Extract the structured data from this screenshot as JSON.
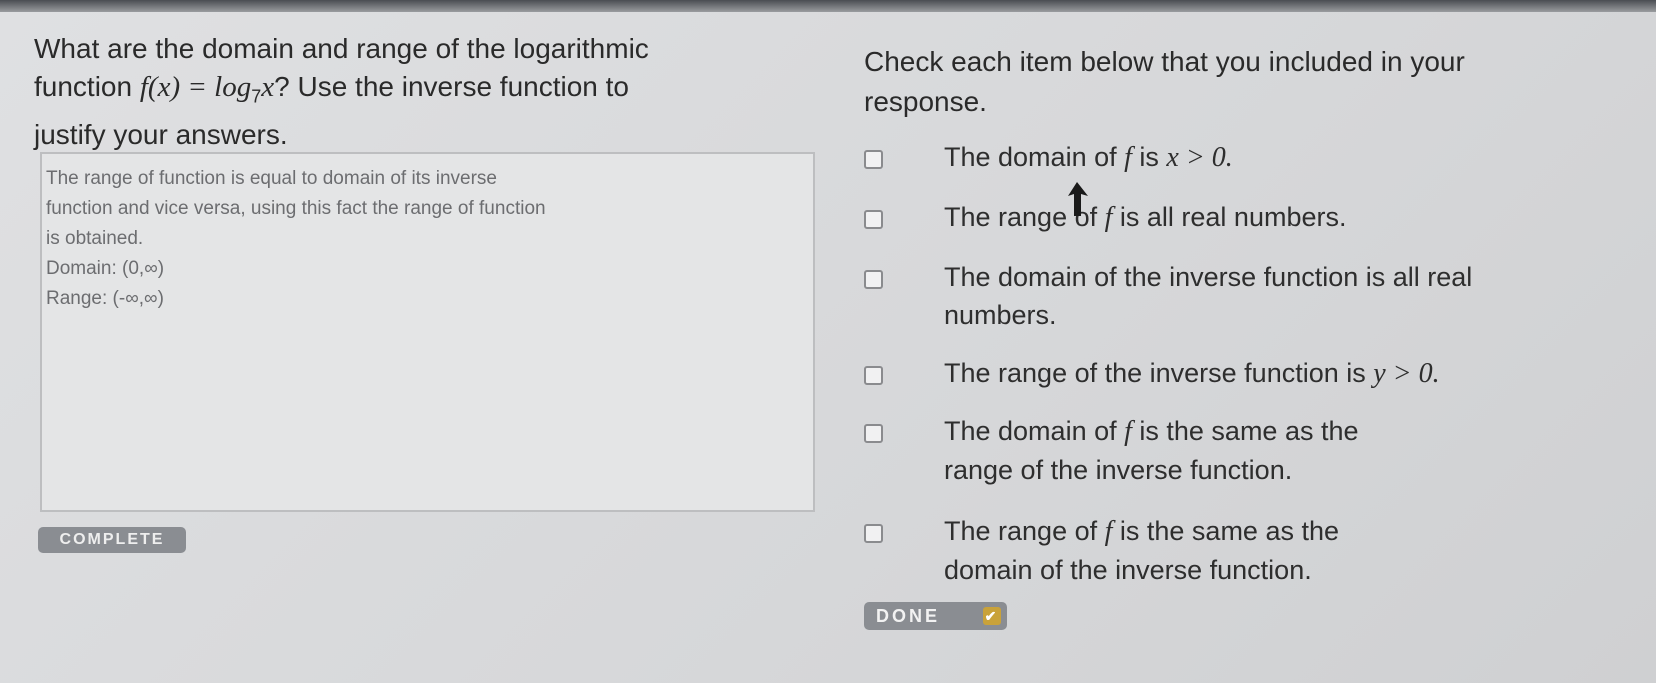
{
  "question": {
    "line1": "What are the domain and range of the logarithmic",
    "line2_pre": "function ",
    "line2_func": "f(x) = log",
    "line2_sub": "7",
    "line2_var": "x",
    "line2_post": "? Use the inverse function to",
    "line3": "justify your answers."
  },
  "answer": {
    "line1": "The range of function is equal to domain of its inverse",
    "line2": "function and vice versa, using this fact the range of function",
    "line3": "is obtained.",
    "line4": "Domain: (0,∞)",
    "line5": "Range: (-∞,∞)"
  },
  "complete_label": "COMPLETE",
  "checklist": {
    "title_line1": "Check each item below that you included in your",
    "title_line2": "response.",
    "items": [
      {
        "a": "The domain of ",
        "f": "f",
        "b": " is ",
        "m": "x > 0."
      },
      {
        "a": "The range of ",
        "f": "f",
        "b": " is all real numbers."
      },
      {
        "l1": "The domain of the inverse function is all real",
        "l2": "numbers."
      },
      {
        "a": "The range of the inverse function is ",
        "m": "y > 0."
      },
      {
        "a": "The domain of ",
        "f": "f",
        "b": " is the same as the",
        "l2": "range of the inverse function."
      },
      {
        "a": "The range of ",
        "f": "f",
        "b": " is the same as the",
        "l2": "domain of the inverse function."
      }
    ]
  },
  "done_label": "DONE",
  "done_icon": "checkmark-icon",
  "colors": {
    "button_bg": "#8a8d92",
    "done_check": "#c9a23a"
  }
}
